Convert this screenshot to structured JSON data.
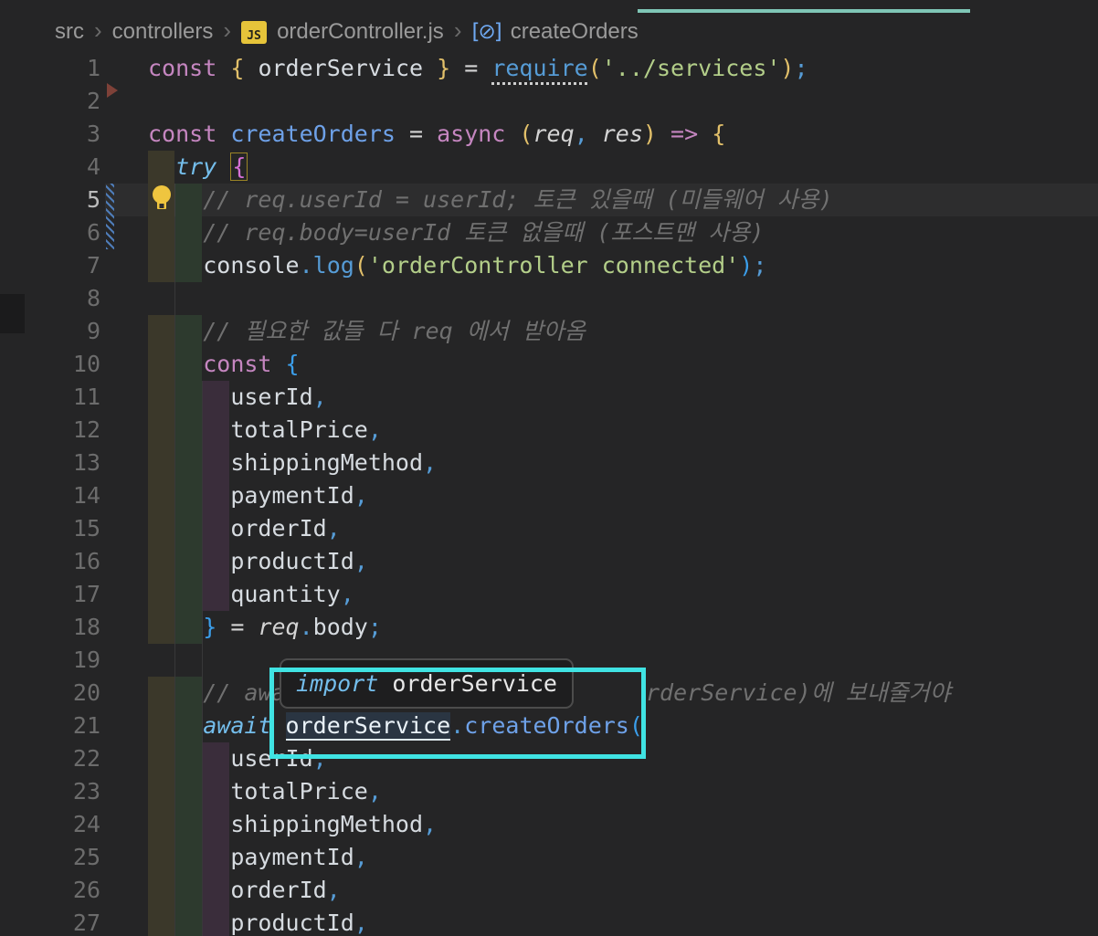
{
  "breadcrumb": {
    "items": [
      "src",
      "controllers",
      "orderController.js",
      "createOrders"
    ],
    "js_badge": "JS",
    "symbol_icon": "[⊘]"
  },
  "editor": {
    "tooltip": {
      "keyword": "import",
      "symbol": " orderService"
    },
    "lines": [
      {
        "n": 1,
        "ind": 0,
        "tokens": [
          [
            "kw",
            "const"
          ],
          [
            "op",
            " "
          ],
          [
            "gold",
            "{"
          ],
          [
            "id",
            " orderService "
          ],
          [
            "gold",
            "}"
          ],
          [
            "op",
            " = "
          ],
          [
            "req",
            "require"
          ],
          [
            "gold",
            "("
          ],
          [
            "str",
            "'../services'"
          ],
          [
            "gold",
            ")"
          ],
          [
            "pb",
            ";"
          ]
        ]
      },
      {
        "n": 2,
        "ind": 0,
        "tokens": []
      },
      {
        "n": 3,
        "ind": 0,
        "tokens": [
          [
            "kw",
            "const "
          ],
          [
            "decl",
            "createOrders"
          ],
          [
            "op",
            " = "
          ],
          [
            "kw",
            "async"
          ],
          [
            "op",
            " "
          ],
          [
            "gold",
            "("
          ],
          [
            "itid",
            "req"
          ],
          [
            "pb",
            ","
          ],
          [
            "itid",
            " res"
          ],
          [
            "gold",
            ")"
          ],
          [
            "op",
            " "
          ],
          [
            "kw",
            "=>"
          ],
          [
            "op",
            " "
          ],
          [
            "gold",
            "{"
          ]
        ]
      },
      {
        "n": 4,
        "ind": 2,
        "tokens": [
          [
            "ctrl",
            "try"
          ],
          [
            "op",
            " "
          ],
          [
            "pinkbox",
            "{"
          ]
        ]
      },
      {
        "n": 5,
        "ind": 4,
        "current": true,
        "tokens": [
          [
            "cmt",
            "// req.userId = userId; 토큰 있을때 (미들웨어 사용)"
          ]
        ]
      },
      {
        "n": 6,
        "ind": 4,
        "tokens": [
          [
            "cmt",
            "// req.body=userId 토큰 없을때 (포스트맨 사용)"
          ]
        ]
      },
      {
        "n": 7,
        "ind": 4,
        "tokens": [
          [
            "id",
            "console"
          ],
          [
            "pb",
            "."
          ],
          [
            "fn",
            "log"
          ],
          [
            "gold",
            "("
          ],
          [
            "str",
            "'orderController connected'"
          ],
          [
            "bblue",
            ")"
          ],
          [
            "pb",
            ";"
          ]
        ]
      },
      {
        "n": 8,
        "ind": 0,
        "guides": true,
        "tokens": []
      },
      {
        "n": 9,
        "ind": 4,
        "tokens": [
          [
            "cmt",
            "// 필요한 값들 다 req 에서 받아옴"
          ]
        ]
      },
      {
        "n": 10,
        "ind": 4,
        "tokens": [
          [
            "kw",
            "const"
          ],
          [
            "op",
            " "
          ],
          [
            "bblue",
            "{"
          ]
        ]
      },
      {
        "n": 11,
        "ind": 6,
        "tokens": [
          [
            "id",
            "userId"
          ],
          [
            "pb",
            ","
          ]
        ]
      },
      {
        "n": 12,
        "ind": 6,
        "tokens": [
          [
            "id",
            "totalPrice"
          ],
          [
            "pb",
            ","
          ]
        ]
      },
      {
        "n": 13,
        "ind": 6,
        "tokens": [
          [
            "id",
            "shippingMethod"
          ],
          [
            "pb",
            ","
          ]
        ]
      },
      {
        "n": 14,
        "ind": 6,
        "tokens": [
          [
            "id",
            "paymentId"
          ],
          [
            "pb",
            ","
          ]
        ]
      },
      {
        "n": 15,
        "ind": 6,
        "tokens": [
          [
            "id",
            "orderId"
          ],
          [
            "pb",
            ","
          ]
        ]
      },
      {
        "n": 16,
        "ind": 6,
        "tokens": [
          [
            "id",
            "productId"
          ],
          [
            "pb",
            ","
          ]
        ]
      },
      {
        "n": 17,
        "ind": 6,
        "tokens": [
          [
            "id",
            "quantity"
          ],
          [
            "pb",
            ","
          ]
        ]
      },
      {
        "n": 18,
        "ind": 4,
        "tokens": [
          [
            "bblue",
            "}"
          ],
          [
            "op",
            " = "
          ],
          [
            "itid",
            "req"
          ],
          [
            "pb",
            "."
          ],
          [
            "id",
            "body"
          ],
          [
            "pb",
            ";"
          ]
        ]
      },
      {
        "n": 19,
        "ind": 0,
        "guides": true,
        "tokens": []
      },
      {
        "n": 20,
        "ind": 4,
        "tokens": [
          [
            "cmt",
            "// awa"
          ]
        ],
        "right_fragment": "rderService)에 보내줄거야"
      },
      {
        "n": 21,
        "ind": 4,
        "tokens": [
          [
            "ctrl",
            "await"
          ],
          [
            "op",
            " "
          ],
          [
            "hl",
            "orderService"
          ],
          [
            "pb",
            "."
          ],
          [
            "decl",
            "createOrders"
          ],
          [
            "bblue",
            "("
          ]
        ]
      },
      {
        "n": 22,
        "ind": 6,
        "tokens": [
          [
            "id",
            "userId"
          ],
          [
            "pb",
            ","
          ]
        ]
      },
      {
        "n": 23,
        "ind": 6,
        "tokens": [
          [
            "id",
            "totalPrice"
          ],
          [
            "pb",
            ","
          ]
        ]
      },
      {
        "n": 24,
        "ind": 6,
        "tokens": [
          [
            "id",
            "shippingMethod"
          ],
          [
            "pb",
            ","
          ]
        ]
      },
      {
        "n": 25,
        "ind": 6,
        "tokens": [
          [
            "id",
            "paymentId"
          ],
          [
            "pb",
            ","
          ]
        ]
      },
      {
        "n": 26,
        "ind": 6,
        "tokens": [
          [
            "id",
            "orderId"
          ],
          [
            "pb",
            ","
          ]
        ]
      },
      {
        "n": 27,
        "ind": 6,
        "tokens": [
          [
            "id",
            "productId"
          ],
          [
            "pb",
            ","
          ]
        ]
      }
    ]
  },
  "colors": {
    "background": "#252526",
    "accent_cyan_box": "#40E3E3",
    "top_teal_line": "#7FC6B6",
    "keyword_purple": "#C586C0",
    "control_keyword_blue": "#74BEEC",
    "string_green": "#B3CE89",
    "comment_gray": "#707070",
    "bracket_gold": "#E2C06A",
    "bracket_pink": "#D670D6",
    "bracket_blue": "#3B9EEA",
    "js_badge_gold": "#E6C43A",
    "lightbulb_yellow": "#EFC53F",
    "indent_band_olive": "#3B382A",
    "indent_band_green": "#2D3A2E",
    "indent_band_purple": "#3A2D3B"
  }
}
